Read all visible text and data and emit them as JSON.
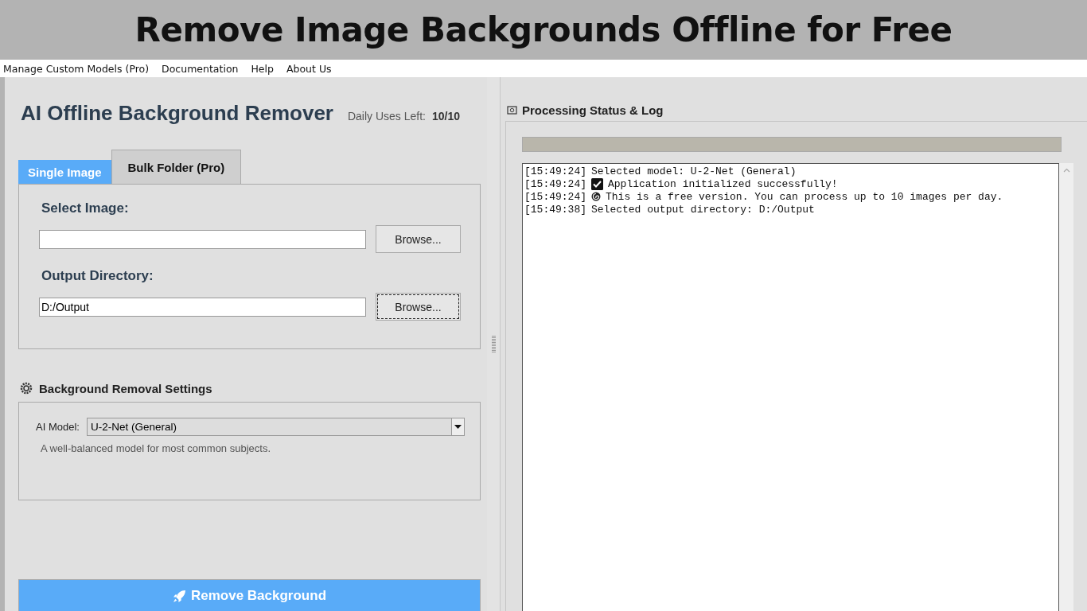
{
  "banner": {
    "title": "Remove Image Backgrounds Offline for Free"
  },
  "menu": [
    {
      "label": "Manage Custom Models (Pro)"
    },
    {
      "label": "Documentation"
    },
    {
      "label": "Help"
    },
    {
      "label": "About Us"
    }
  ],
  "app": {
    "title": "AI Offline Background Remover",
    "uses_label": "Daily Uses Left:",
    "uses_value": "10/10"
  },
  "tabs": [
    {
      "label": "Single Image",
      "selected": true
    },
    {
      "label": "Bulk Folder (Pro)",
      "selected": false
    }
  ],
  "fields": [
    {
      "label": "Select Image:",
      "button": "Browse...",
      "focused": false
    },
    {
      "label": "Output Directory:",
      "value": "D:/Output",
      "button": "Browse...",
      "focused": true
    }
  ],
  "settings": {
    "title": "Background Removal Settings",
    "model_label": "AI Model:",
    "model_value": "U-2-Net (General)",
    "description": "A well-balanced model for most common subjects."
  },
  "action_button": {
    "label": "Remove Background"
  },
  "log_panel": {
    "title": "Processing Status & Log",
    "progress": {
      "level": 0
    },
    "entries": [
      {
        "time": "[15:49:24]",
        "kind": "plain",
        "text": "Selected model: U-2-Net (General)"
      },
      {
        "time": "[15:49:24]",
        "kind": "success",
        "text": "Application initialized successfully!"
      },
      {
        "time": "[15:49:24]",
        "kind": "info",
        "text": "This is a free version. You can process up to 10 images per day."
      },
      {
        "time": "[15:49:38]",
        "kind": "plain",
        "text": "Selected output directory: D:/Output"
      }
    ]
  }
}
